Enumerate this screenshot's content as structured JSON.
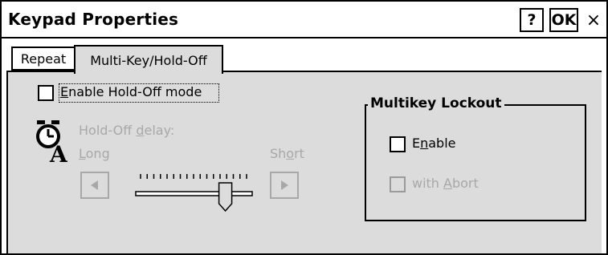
{
  "window": {
    "title": "Keypad Properties",
    "help_button": "?",
    "ok_button": "OK",
    "close_button": "×"
  },
  "tabs": [
    {
      "label": "Repeat",
      "selected": false
    },
    {
      "label": "Multi-Key/Hold-Off",
      "selected": true
    }
  ],
  "hold_off": {
    "enable_checkbox": {
      "prefix": "",
      "mnemonic": "E",
      "rest": "nable Hold-Off mode",
      "checked": false
    },
    "delay_label": {
      "prefix": "Hold-Off ",
      "mnemonic": "d",
      "rest": "elay:"
    },
    "long_label": {
      "prefix": "",
      "mnemonic": "L",
      "rest": "ong"
    },
    "short_label": {
      "prefix": "Sh",
      "mnemonic": "o",
      "rest": "rt"
    },
    "slider_value": 0.8,
    "left_arrow_icon": "left-triangle",
    "right_arrow_icon": "right-triangle",
    "delay_icon": "stopwatch-a-icon"
  },
  "multikey": {
    "group_title": "Multikey Lockout",
    "enable": {
      "prefix": "E",
      "mnemonic": "n",
      "rest": "able",
      "checked": false
    },
    "with_abort": {
      "prefix": "with ",
      "mnemonic": "A",
      "rest": "bort",
      "checked": false
    }
  },
  "colors": {
    "panel_bg": "#dcdcdc",
    "disabled_text": "#a8a8a8",
    "border": "#000000"
  }
}
